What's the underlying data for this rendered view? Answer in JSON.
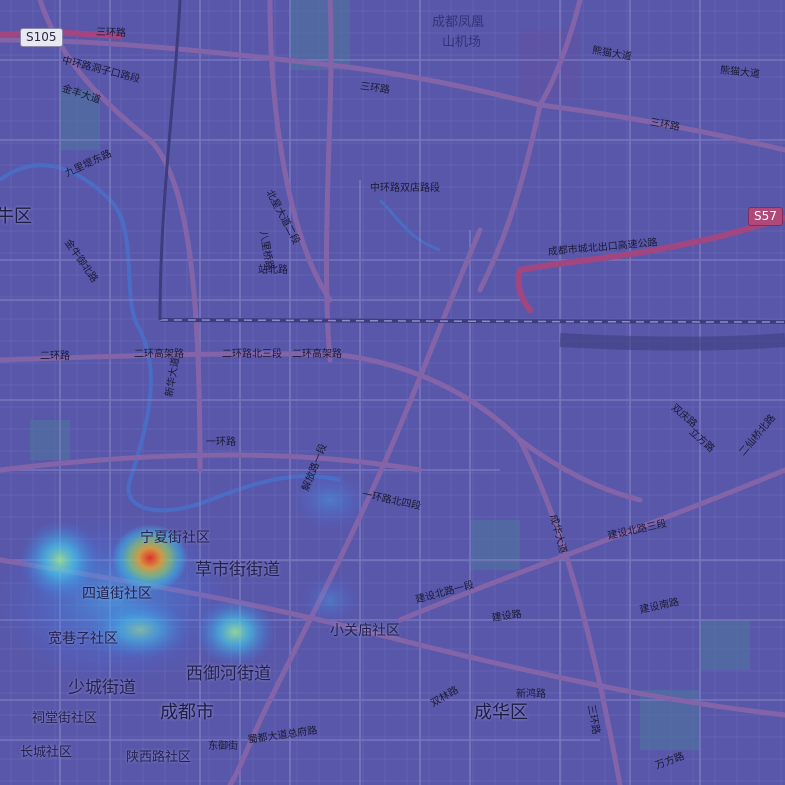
{
  "map": {
    "district_labels": {
      "niu": "牛区",
      "chengdu_city": "成都市",
      "chenghua": "成华区"
    },
    "subdistrict_labels": {
      "caoshijie": "草市街街道",
      "xiyuhe": "西御河街道",
      "shaocheng": "少城街道",
      "ningxia": "宁夏街社区",
      "sidaojie": "四道街社区",
      "kuanxiangzi": "宽巷子社区",
      "xiaoguanmiao": "小关庙社区",
      "citangjie": "祠堂街社区",
      "changcheng": "长城社区",
      "shaanxi": "陕西路社区"
    },
    "poi": {
      "fenghuang_line1": "成都凤凰",
      "fenghuang_line2": "山机场"
    },
    "shields": {
      "s105": "S105",
      "s57": "S57"
    },
    "road_labels": {
      "sanhuan_nw": "三环路",
      "sanhuan_n": "三环路",
      "sanhuan_e": "三环路",
      "zhonghuan_dongzikou": "中环路洞子口路段",
      "jinfeng": "金丰大道",
      "xiongmao1": "熊猫大道",
      "xiongmao2": "熊猫大道",
      "jiuli": "九里堤东路",
      "jinniu_yuji": "金牛御北路",
      "beixingdadao": "北星大道二段",
      "bazi": "八里桥路",
      "chukou": "成都市城北出口高速公路",
      "zhonghuan_shuangdian": "中环路双店路段",
      "zhanbei": "站北路",
      "erhuan_w": "二环路",
      "erhuan_gaojia": "二环高架路",
      "erhuan_bei3": "二环路北三段",
      "erhuan_gaojia2": "二环高架路",
      "yihuan": "一环路",
      "xinhong": "新鸿路",
      "shuanglin": "双林路",
      "chenghua_road": "成华大道",
      "jianshe_bei3": "建设北路三段",
      "jianshe_bei1": "建设北路一段",
      "jianshe": "建设路",
      "jianshe_nan": "建设南路",
      "shuangqing": "双庆路",
      "erxianqiao": "二仙桥北路",
      "sanhuan_se": "三环路",
      "yihuan_bei4": "一环路北四段",
      "shudu": "蜀都大道总府路",
      "jiefang": "解放路一段",
      "xinhua": "新华大道",
      "dongyu": "东御街",
      "lifang": "立方路",
      "wanfang": "万方路"
    }
  },
  "colors": {
    "tint": "#5c5aa6",
    "major_road": "#8e6aa8",
    "minor_road": "#7d7bb8",
    "expressway": "#b0487a",
    "rail": "#3e3d78",
    "heat_hot": "#ff3a10",
    "heat_warm": "#ffe030",
    "heat_cool": "#30f0ff"
  }
}
